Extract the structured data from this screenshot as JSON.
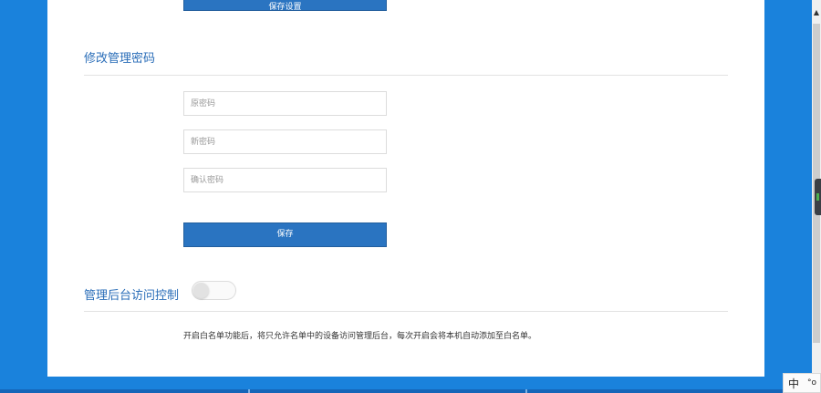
{
  "top_button": {
    "label": "保存设置"
  },
  "password_section": {
    "title": "修改管理密码",
    "old_password": {
      "placeholder": "原密码"
    },
    "new_password": {
      "placeholder": "新密码"
    },
    "confirm_password": {
      "placeholder": "确认密码"
    },
    "save_label": "保存"
  },
  "access_section": {
    "title": "管理后台访问控制",
    "toggle": {
      "enabled": false
    },
    "help": "开启白名单功能后，将只允许名单中的设备访问管理后台，每次开启会将本机自动添加至白名单。"
  },
  "scrollbar": {
    "up_arrow": "▲"
  },
  "ime": {
    "language": "中",
    "punctuation": "°o"
  }
}
